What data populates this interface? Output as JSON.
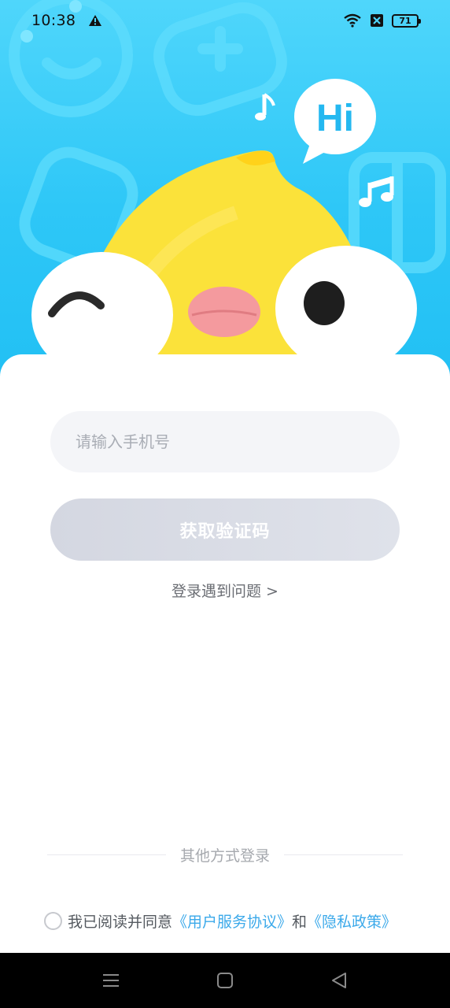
{
  "status_bar": {
    "time": "10:38",
    "battery": "71",
    "icons": [
      "warning-icon",
      "wifi-icon",
      "no-sim-icon",
      "battery-icon"
    ]
  },
  "login": {
    "phone_placeholder": "请输入手机号",
    "get_code_label": "获取验证码",
    "help_link": "登录遇到问题 >",
    "other_login_label": "其他方式登录"
  },
  "agreement": {
    "prefix": "我已阅读并同意",
    "terms_link": "《用户服务协议》",
    "conjunction": "和",
    "privacy_link": "《隐私政策》"
  },
  "hero": {
    "bubble_text": "Hi"
  },
  "nav_bar": {
    "icons": [
      "menu-icon",
      "home-icon",
      "back-icon"
    ]
  },
  "colors": {
    "sky": "#2ec7f7",
    "mascot_yellow": "#fbe23a",
    "button_disabled": "#d4d7e1",
    "link": "#3ba9ea"
  }
}
